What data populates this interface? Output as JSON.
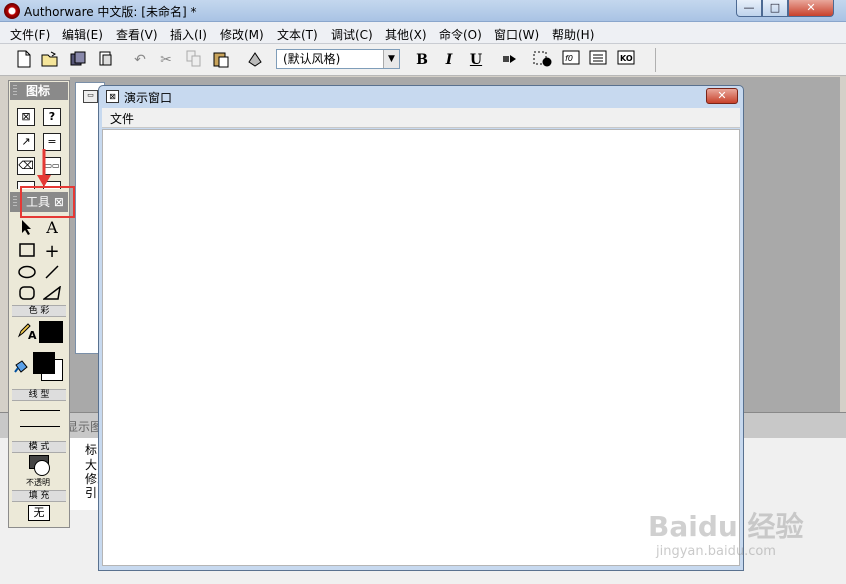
{
  "window": {
    "title": "Authorware 中文版: [未命名] *",
    "min": "—",
    "max": "□",
    "close": "✕"
  },
  "menu": [
    "文件(F)",
    "编辑(E)",
    "查看(V)",
    "插入(I)",
    "修改(M)",
    "文本(T)",
    "调试(C)",
    "其他(X)",
    "命令(O)",
    "窗口(W)",
    "帮助(H)"
  ],
  "toolbar": {
    "style_value": "(默认风格)",
    "bold": "B",
    "italic": "I",
    "underline": "U",
    "icons": [
      "new-icon",
      "open-icon",
      "save-all-icon",
      "import-icon",
      "undo-icon",
      "cut-icon",
      "copy-icon",
      "paste-icon",
      "find-icon",
      "run-icon",
      "restart-icon",
      "functions-icon",
      "variables-icon",
      "knowledge-objects-icon"
    ]
  },
  "icons_palette": {
    "title": "图标"
  },
  "tools_palette": {
    "title": "工具 ⊠",
    "sections": {
      "color": "色 彩",
      "line_type": "线 型",
      "mode": "模 式",
      "mode_value": "不透明",
      "fill": "填 充",
      "fill_value": "无"
    },
    "tools": [
      "select-arrow",
      "text-tool",
      "rectangle-tool",
      "crosshair-tool",
      "ellipse-tool",
      "line-tool",
      "rounded-rectangle-tool",
      "polygon-tool"
    ]
  },
  "presentation_window": {
    "title": "演示窗口",
    "close": "✕",
    "menu_file": "文件"
  },
  "props_panel": {
    "title": "显示图",
    "labels": [
      "标",
      "大",
      "修改",
      "引"
    ]
  },
  "watermark": {
    "logo": "Baidu 经验",
    "url": "jingyan.baidu.com"
  },
  "colors": {
    "highlight": "#e53935",
    "titlebar": "#a9c3e4"
  }
}
